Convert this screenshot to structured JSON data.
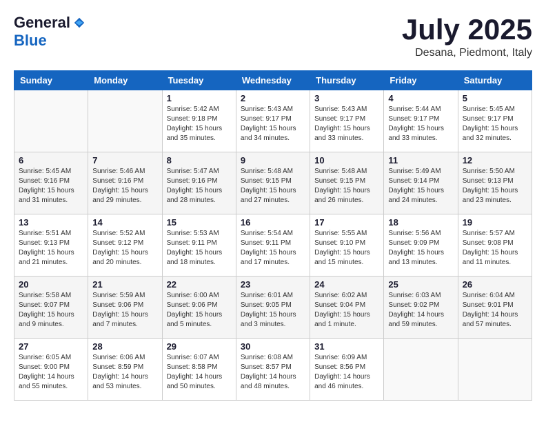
{
  "header": {
    "logo": {
      "general": "General",
      "blue": "Blue"
    },
    "title": "July 2025",
    "location": "Desana, Piedmont, Italy"
  },
  "calendar": {
    "headers": [
      "Sunday",
      "Monday",
      "Tuesday",
      "Wednesday",
      "Thursday",
      "Friday",
      "Saturday"
    ],
    "weeks": [
      [
        {
          "day": "",
          "info": ""
        },
        {
          "day": "",
          "info": ""
        },
        {
          "day": "1",
          "info": "Sunrise: 5:42 AM\nSunset: 9:18 PM\nDaylight: 15 hours\nand 35 minutes."
        },
        {
          "day": "2",
          "info": "Sunrise: 5:43 AM\nSunset: 9:17 PM\nDaylight: 15 hours\nand 34 minutes."
        },
        {
          "day": "3",
          "info": "Sunrise: 5:43 AM\nSunset: 9:17 PM\nDaylight: 15 hours\nand 33 minutes."
        },
        {
          "day": "4",
          "info": "Sunrise: 5:44 AM\nSunset: 9:17 PM\nDaylight: 15 hours\nand 33 minutes."
        },
        {
          "day": "5",
          "info": "Sunrise: 5:45 AM\nSunset: 9:17 PM\nDaylight: 15 hours\nand 32 minutes."
        }
      ],
      [
        {
          "day": "6",
          "info": "Sunrise: 5:45 AM\nSunset: 9:16 PM\nDaylight: 15 hours\nand 31 minutes."
        },
        {
          "day": "7",
          "info": "Sunrise: 5:46 AM\nSunset: 9:16 PM\nDaylight: 15 hours\nand 29 minutes."
        },
        {
          "day": "8",
          "info": "Sunrise: 5:47 AM\nSunset: 9:16 PM\nDaylight: 15 hours\nand 28 minutes."
        },
        {
          "day": "9",
          "info": "Sunrise: 5:48 AM\nSunset: 9:15 PM\nDaylight: 15 hours\nand 27 minutes."
        },
        {
          "day": "10",
          "info": "Sunrise: 5:48 AM\nSunset: 9:15 PM\nDaylight: 15 hours\nand 26 minutes."
        },
        {
          "day": "11",
          "info": "Sunrise: 5:49 AM\nSunset: 9:14 PM\nDaylight: 15 hours\nand 24 minutes."
        },
        {
          "day": "12",
          "info": "Sunrise: 5:50 AM\nSunset: 9:13 PM\nDaylight: 15 hours\nand 23 minutes."
        }
      ],
      [
        {
          "day": "13",
          "info": "Sunrise: 5:51 AM\nSunset: 9:13 PM\nDaylight: 15 hours\nand 21 minutes."
        },
        {
          "day": "14",
          "info": "Sunrise: 5:52 AM\nSunset: 9:12 PM\nDaylight: 15 hours\nand 20 minutes."
        },
        {
          "day": "15",
          "info": "Sunrise: 5:53 AM\nSunset: 9:11 PM\nDaylight: 15 hours\nand 18 minutes."
        },
        {
          "day": "16",
          "info": "Sunrise: 5:54 AM\nSunset: 9:11 PM\nDaylight: 15 hours\nand 17 minutes."
        },
        {
          "day": "17",
          "info": "Sunrise: 5:55 AM\nSunset: 9:10 PM\nDaylight: 15 hours\nand 15 minutes."
        },
        {
          "day": "18",
          "info": "Sunrise: 5:56 AM\nSunset: 9:09 PM\nDaylight: 15 hours\nand 13 minutes."
        },
        {
          "day": "19",
          "info": "Sunrise: 5:57 AM\nSunset: 9:08 PM\nDaylight: 15 hours\nand 11 minutes."
        }
      ],
      [
        {
          "day": "20",
          "info": "Sunrise: 5:58 AM\nSunset: 9:07 PM\nDaylight: 15 hours\nand 9 minutes."
        },
        {
          "day": "21",
          "info": "Sunrise: 5:59 AM\nSunset: 9:06 PM\nDaylight: 15 hours\nand 7 minutes."
        },
        {
          "day": "22",
          "info": "Sunrise: 6:00 AM\nSunset: 9:06 PM\nDaylight: 15 hours\nand 5 minutes."
        },
        {
          "day": "23",
          "info": "Sunrise: 6:01 AM\nSunset: 9:05 PM\nDaylight: 15 hours\nand 3 minutes."
        },
        {
          "day": "24",
          "info": "Sunrise: 6:02 AM\nSunset: 9:04 PM\nDaylight: 15 hours\nand 1 minute."
        },
        {
          "day": "25",
          "info": "Sunrise: 6:03 AM\nSunset: 9:02 PM\nDaylight: 14 hours\nand 59 minutes."
        },
        {
          "day": "26",
          "info": "Sunrise: 6:04 AM\nSunset: 9:01 PM\nDaylight: 14 hours\nand 57 minutes."
        }
      ],
      [
        {
          "day": "27",
          "info": "Sunrise: 6:05 AM\nSunset: 9:00 PM\nDaylight: 14 hours\nand 55 minutes."
        },
        {
          "day": "28",
          "info": "Sunrise: 6:06 AM\nSunset: 8:59 PM\nDaylight: 14 hours\nand 53 minutes."
        },
        {
          "day": "29",
          "info": "Sunrise: 6:07 AM\nSunset: 8:58 PM\nDaylight: 14 hours\nand 50 minutes."
        },
        {
          "day": "30",
          "info": "Sunrise: 6:08 AM\nSunset: 8:57 PM\nDaylight: 14 hours\nand 48 minutes."
        },
        {
          "day": "31",
          "info": "Sunrise: 6:09 AM\nSunset: 8:56 PM\nDaylight: 14 hours\nand 46 minutes."
        },
        {
          "day": "",
          "info": ""
        },
        {
          "day": "",
          "info": ""
        }
      ]
    ]
  }
}
